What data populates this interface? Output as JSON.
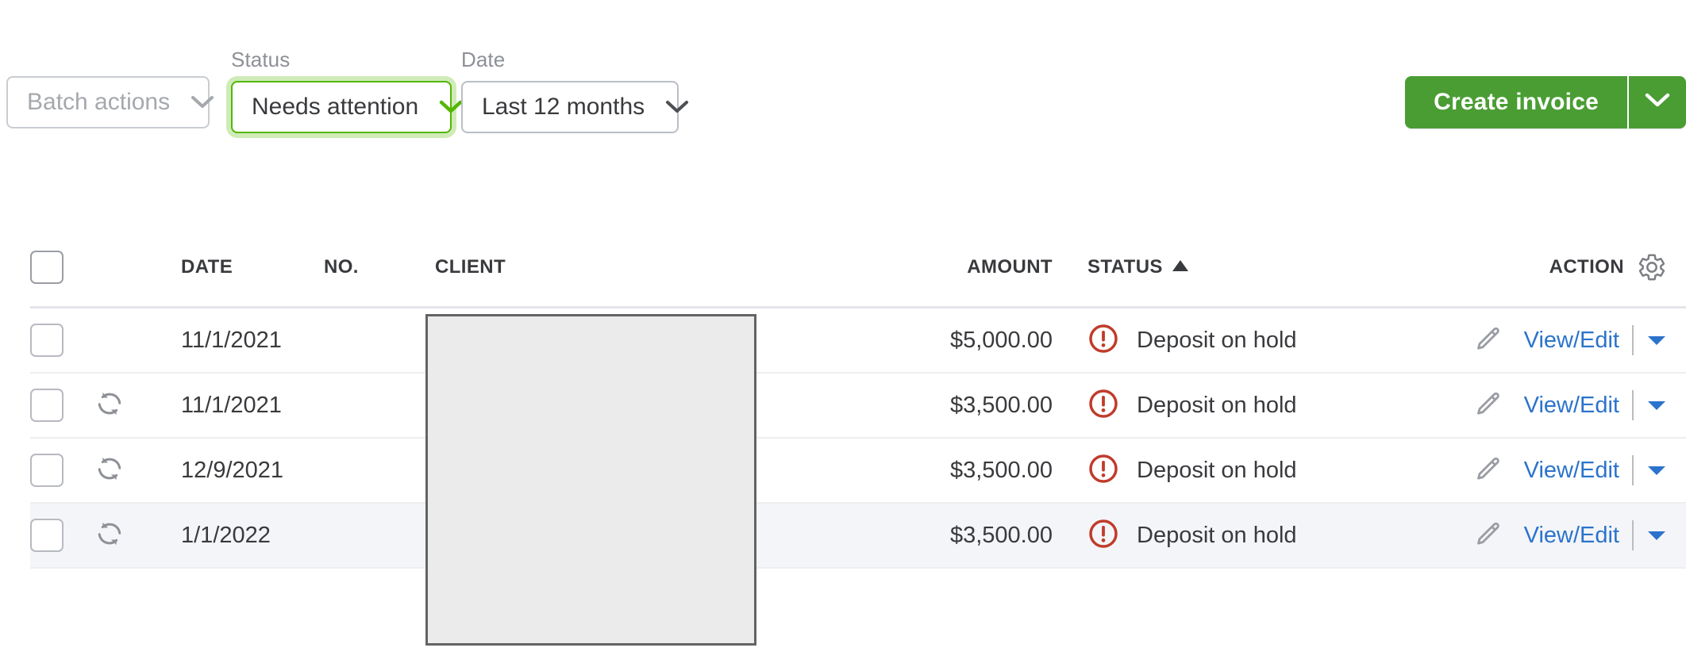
{
  "toolbar": {
    "batch_actions": {
      "label": "Batch actions",
      "disabled": true,
      "icon": "chevron-down-icon"
    },
    "status_filter": {
      "label": "Status",
      "value": "Needs attention",
      "focused": true,
      "icon": "chevron-down-icon"
    },
    "date_filter": {
      "label": "Date",
      "value": "Last 12 months",
      "icon": "chevron-down-icon"
    },
    "create_invoice": {
      "label": "Create invoice",
      "caret_icon": "chevron-down-icon"
    }
  },
  "colors": {
    "brand_green": "#4a9d33",
    "focus_green": "#53b700",
    "link_blue": "#2b73cc",
    "alert_red": "#c03b2b",
    "row_highlight": "#f4f5f8",
    "text": "#393a3d",
    "muted": "#8d9096"
  },
  "table": {
    "headers": {
      "select_all": "",
      "recurring": "",
      "date": "DATE",
      "no": "NO.",
      "client": "CLIENT",
      "amount": "AMOUNT",
      "status": "STATUS",
      "status_sort": "ascending",
      "action": "ACTION",
      "action_gear_icon": "gear-icon"
    },
    "rows": [
      {
        "recurring": false,
        "date": "11/1/2021",
        "no": "",
        "client": "",
        "amount": "$5,000.00",
        "status": "Deposit on hold",
        "status_icon": "alert-circle-icon",
        "action": "View/Edit",
        "highlight": false
      },
      {
        "recurring": true,
        "recurring_icon": "recurring-icon",
        "date": "11/1/2021",
        "no": "",
        "client": "",
        "amount": "$3,500.00",
        "status": "Deposit on hold",
        "status_icon": "alert-circle-icon",
        "action": "View/Edit",
        "highlight": false
      },
      {
        "recurring": true,
        "recurring_icon": "recurring-icon",
        "date": "12/9/2021",
        "no": "",
        "client": "",
        "amount": "$3,500.00",
        "status": "Deposit on hold",
        "status_icon": "alert-circle-icon",
        "action": "View/Edit",
        "highlight": false
      },
      {
        "recurring": true,
        "recurring_icon": "recurring-icon",
        "date": "1/1/2022",
        "no": "",
        "client": "",
        "amount": "$3,500.00",
        "status": "Deposit on hold",
        "status_icon": "alert-circle-icon",
        "action": "View/Edit",
        "highlight": true
      }
    ]
  },
  "overlay": {
    "occluder": ""
  }
}
